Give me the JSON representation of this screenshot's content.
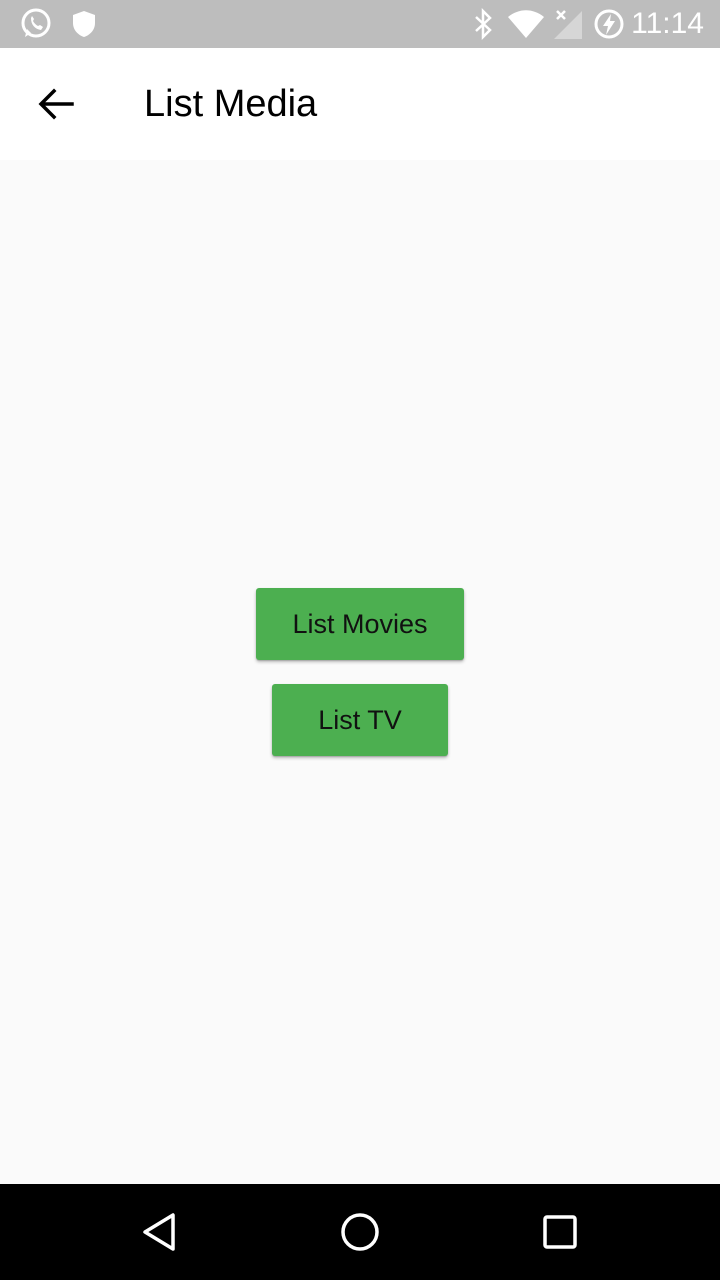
{
  "status_bar": {
    "time": "11:14",
    "icons": [
      "whatsapp-icon",
      "shield-icon",
      "bluetooth-icon",
      "wifi-icon",
      "signal-off-icon",
      "battery-charging-icon"
    ],
    "background": "#bdbdbd"
  },
  "app_bar": {
    "title": "List Media",
    "back_icon": "arrow-back-icon"
  },
  "main": {
    "buttons": [
      {
        "label": "List Movies",
        "color": "#4caf50"
      },
      {
        "label": "List TV",
        "color": "#4caf50"
      }
    ]
  },
  "nav_bar": {
    "buttons": [
      "back-triangle-icon",
      "home-circle-icon",
      "recents-square-icon"
    ]
  }
}
